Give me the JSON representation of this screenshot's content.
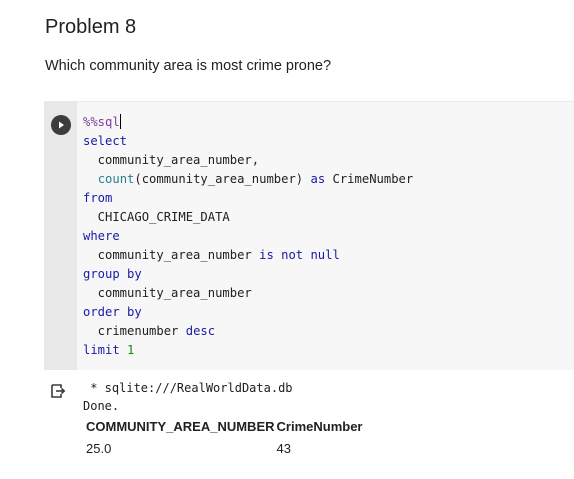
{
  "heading": "Problem 8",
  "question": "Which community area is most crime prone?",
  "cell": {
    "run_icon": "play-icon",
    "lines": [
      {
        "parts": [
          {
            "t": "%%sql",
            "c": "magic"
          }
        ],
        "cursor": true
      },
      {
        "parts": [
          {
            "t": "select",
            "c": "kw"
          }
        ]
      },
      {
        "parts": [
          {
            "t": "  community_area_number,",
            "c": ""
          }
        ]
      },
      {
        "parts": [
          {
            "t": "  ",
            "c": ""
          },
          {
            "t": "count",
            "c": "fn"
          },
          {
            "t": "(community_area_number) ",
            "c": ""
          },
          {
            "t": "as",
            "c": "kw"
          },
          {
            "t": " CrimeNumber",
            "c": ""
          }
        ]
      },
      {
        "parts": [
          {
            "t": "from",
            "c": "kw"
          }
        ]
      },
      {
        "parts": [
          {
            "t": "  CHICAGO_CRIME_DATA",
            "c": ""
          }
        ]
      },
      {
        "parts": [
          {
            "t": "where",
            "c": "kw"
          }
        ]
      },
      {
        "parts": [
          {
            "t": "  community_area_number ",
            "c": ""
          },
          {
            "t": "is not null",
            "c": "kw"
          }
        ]
      },
      {
        "parts": [
          {
            "t": "group by",
            "c": "kw"
          }
        ]
      },
      {
        "parts": [
          {
            "t": "  community_area_number",
            "c": ""
          }
        ]
      },
      {
        "parts": [
          {
            "t": "order by",
            "c": "kw"
          }
        ]
      },
      {
        "parts": [
          {
            "t": "  crimenumber ",
            "c": ""
          },
          {
            "t": "desc",
            "c": "kw"
          }
        ]
      },
      {
        "parts": [
          {
            "t": "limit",
            "c": "kw"
          },
          {
            "t": " ",
            "c": ""
          },
          {
            "t": "1",
            "c": "num"
          }
        ]
      }
    ]
  },
  "output": {
    "icon": "output-arrow-icon",
    "line1": " * sqlite:///RealWorldData.db",
    "line2": "Done.",
    "table": {
      "headers": [
        "COMMUNITY_AREA_NUMBER",
        "CrimeNumber"
      ],
      "rows": [
        [
          "25.0",
          "43"
        ]
      ]
    }
  },
  "colors": {
    "cell_background": "#f7f7f7",
    "gutter": "#e8e8e8",
    "keyword": "#1a1aa6",
    "function": "#2a7d8c",
    "magic": "#7a3d9a",
    "number": "#0e8a16"
  }
}
